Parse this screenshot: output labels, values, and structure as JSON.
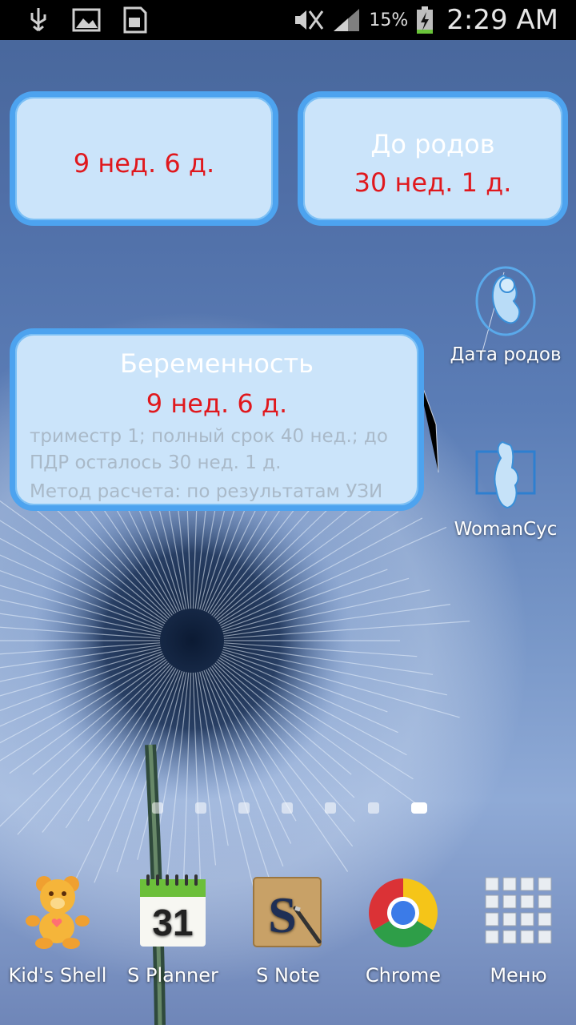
{
  "status_bar": {
    "icons_left": [
      "usb-icon",
      "gallery-icon",
      "sd-card-icon"
    ],
    "icons_right": [
      "mute-icon",
      "signal-icon",
      "battery-charging-icon"
    ],
    "battery": "15%",
    "time": "2:29 AM"
  },
  "widgets": {
    "small_left": {
      "value": "9 нед. 6 д."
    },
    "small_right": {
      "title": "До родов",
      "value": "30 нед. 1 д."
    },
    "large": {
      "title": "Беременность",
      "value": "9 нед. 6 д.",
      "info": "триместр 1; полный срок 40 нед.; до ПДР осталось 30 нед. 1 д.",
      "method": "Метод расчета: по результатам УЗИ"
    }
  },
  "shortcuts": [
    {
      "label": "Дата родов",
      "icon": "fetus-icon"
    },
    {
      "label": "WomanCyc",
      "icon": "pregnant-woman-icon"
    }
  ],
  "pager": {
    "pages": 7,
    "active_index": 6
  },
  "dock": [
    {
      "label": "Kid's Shell",
      "icon": "teddy-bear-icon"
    },
    {
      "label": "S Planner",
      "icon": "calendar-icon",
      "day": "31"
    },
    {
      "label": "S Note",
      "icon": "s-note-icon",
      "letter": "S"
    },
    {
      "label": "Chrome",
      "icon": "chrome-icon"
    },
    {
      "label": "Меню",
      "icon": "apps-grid-icon"
    }
  ],
  "colors": {
    "widget_fill": "#cbe4fa",
    "widget_border": "#4da3ef",
    "value_red": "#e0181d"
  }
}
